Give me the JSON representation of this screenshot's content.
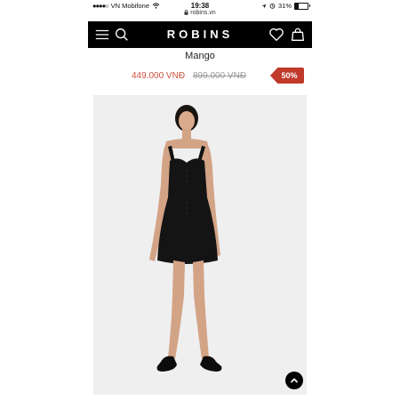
{
  "status": {
    "carrier": "VN Mobifone",
    "time": "19:38",
    "battery": "31%",
    "battery_level": 0.31,
    "url": "robins.vn"
  },
  "header": {
    "logo": "ROBINS"
  },
  "product": {
    "brand": "Mango",
    "price": "449.000 VNĐ",
    "old_price": "899.000 VNĐ",
    "discount": "50%"
  },
  "colors": {
    "header_bg": "#000000",
    "sale_price": "#d0503c",
    "badge": "#c0392b",
    "photo_bg": "#efefef"
  },
  "icons": [
    "signal-icon",
    "wifi-icon",
    "location-icon",
    "alarm-icon",
    "battery-icon",
    "lock-icon",
    "menu-icon",
    "search-icon",
    "heart-icon",
    "bag-icon",
    "chevron-up-icon"
  ]
}
